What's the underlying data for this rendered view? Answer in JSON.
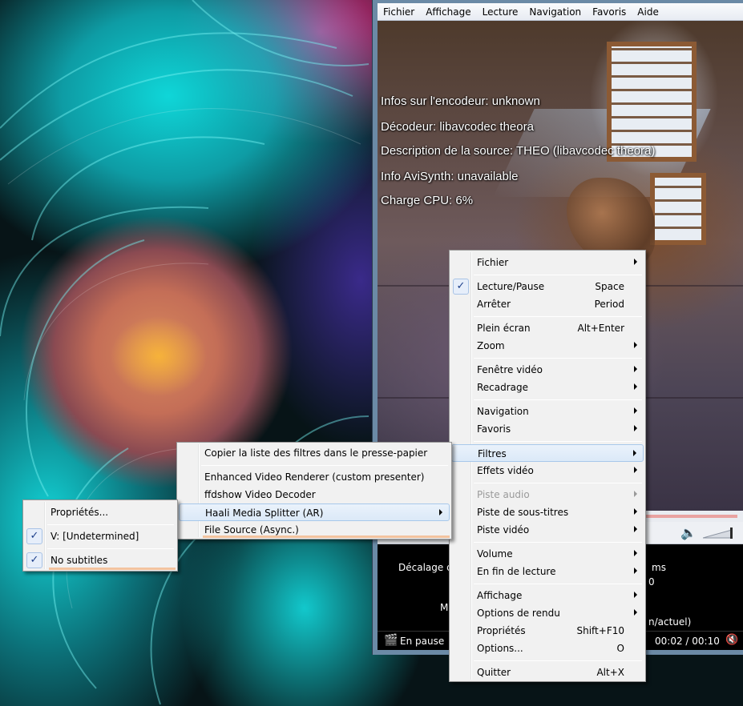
{
  "menubar": [
    "Fichier",
    "Affichage",
    "Lecture",
    "Navigation",
    "Favoris",
    "Aide"
  ],
  "osd": [
    "Infos sur l'encodeur: unknown",
    "Décodeur: libavcodec theora",
    "Description de la source: THEO (libavcodec theora)",
    "Info AviSynth: unavailable",
    "Charge CPU: 6%"
  ],
  "info_panel": {
    "offset_label": "Décalage de",
    "ms": "ms",
    "zero": "0",
    "me": "Me",
    "actuel": "n/actuel)"
  },
  "status": {
    "state": "En pause",
    "time": "00:02 / 00:10"
  },
  "main_menu": {
    "items": [
      {
        "label": "Fichier",
        "submenu": true
      },
      {
        "label": "Lecture/Pause",
        "shortcut": "Space",
        "checked": true
      },
      {
        "label": "Arrêter",
        "shortcut": "Period"
      },
      {
        "label": "Plein écran",
        "shortcut": "Alt+Enter"
      },
      {
        "label": "Zoom",
        "submenu": true
      },
      {
        "label": "Fenêtre vidéo",
        "submenu": true
      },
      {
        "label": "Recadrage",
        "submenu": true
      },
      {
        "label": "Navigation",
        "submenu": true
      },
      {
        "label": "Favoris",
        "submenu": true
      },
      {
        "label": "Filtres",
        "submenu": true,
        "highlighted": true
      },
      {
        "label": "Effets vidéo",
        "submenu": true
      },
      {
        "label": "Piste audio",
        "submenu": true,
        "disabled": true
      },
      {
        "label": "Piste de sous-titres",
        "submenu": true
      },
      {
        "label": "Piste vidéo",
        "submenu": true
      },
      {
        "label": "Volume",
        "submenu": true
      },
      {
        "label": "En fin de lecture",
        "submenu": true
      },
      {
        "label": "Affichage",
        "submenu": true
      },
      {
        "label": "Options de rendu",
        "submenu": true
      },
      {
        "label": "Propriétés",
        "shortcut": "Shift+F10"
      },
      {
        "label": "Options...",
        "shortcut": "O"
      },
      {
        "label": "Quitter",
        "shortcut": "Alt+X"
      }
    ]
  },
  "filters_menu": {
    "items": [
      {
        "label": "Copier la liste des filtres dans le presse-papier"
      },
      {
        "label": "Enhanced Video Renderer (custom presenter)"
      },
      {
        "label": "ffdshow Video Decoder"
      },
      {
        "label": "Haali Media Splitter (AR)",
        "submenu": true,
        "highlighted": true
      },
      {
        "label": "File Source (Async.)"
      }
    ]
  },
  "haali_menu": {
    "items": [
      {
        "label": "Propriétés..."
      },
      {
        "label": "V: [Undetermined]",
        "checked": true
      },
      {
        "label": "No subtitles",
        "checked": true
      }
    ]
  },
  "colors": {
    "menu_bg": "#f1f1f1",
    "highlight_bg": "#dbe9f8",
    "highlight_border": "#a8c8ea",
    "accent_orange": "#f3c39f",
    "wallpaper_cyan": "#0fd6d8",
    "wallpaper_pink": "#e82f8a"
  },
  "icons": {
    "check": "✓",
    "volume": "speaker-icon",
    "status": "film-clapper-icon",
    "mute": "mute-icon"
  }
}
